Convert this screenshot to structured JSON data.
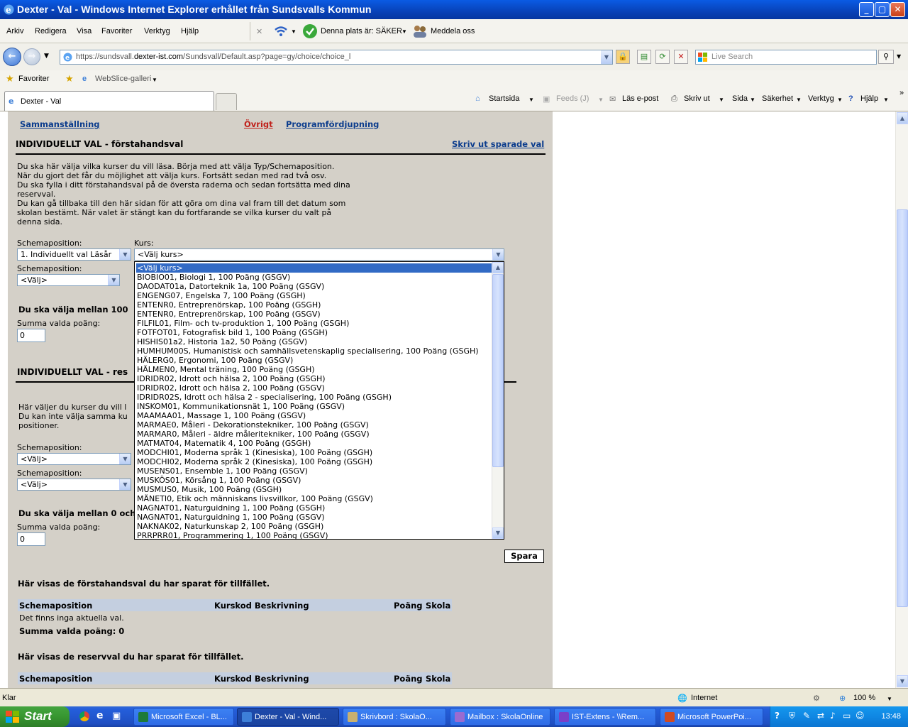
{
  "window": {
    "title": "Dexter - Val - Windows Internet Explorer erhållet från Sundsvalls Kommun",
    "min": "_",
    "max": "▢",
    "close": "✕"
  },
  "menu": [
    "Arkiv",
    "Redigera",
    "Visa",
    "Favoriter",
    "Verktyg",
    "Hjälp"
  ],
  "toolbar": {
    "safe_site": "Denna plats är: SÄKER",
    "notify": "Meddela oss"
  },
  "address": {
    "url_prefix": "https://sundsvall.",
    "url_domain": "dexter-ist.com",
    "url_rest": "/Sundsvall/Default.asp?page=gy/choice/choice_l",
    "search_placeholder": "Live Search"
  },
  "favbar": {
    "favorites": "Favoriter",
    "webslice": "WebSlice-galleri"
  },
  "tab": {
    "title": "Dexter - Val"
  },
  "commandbar": [
    "Startsida",
    "Feeds (J)",
    "Läs e-post",
    "Skriv ut",
    "Sida",
    "Säkerhet",
    "Verktyg",
    "Hjälp"
  ],
  "page": {
    "nav": {
      "summary": "Sammanställning",
      "other": "Övrigt",
      "program": "Programfördjupning"
    },
    "print_link": "Skriv ut sparade val",
    "section1": {
      "title": "INDIVIDUELLT VAL - förstahandsval",
      "intro": [
        "Du ska här välja vilka kurser du vill läsa. Börja med att välja Typ/Schemaposition.",
        "När du gjort det får du möjlighet att välja kurs. Fortsätt sedan med rad två osv.",
        "Du ska fylla i ditt förstahandsval på de översta raderna och sedan fortsätta med dina",
        "reservval.",
        "Du kan gå tillbaka till den här sidan för att göra om dina val fram till det datum som",
        "skolan bestämt. När valet är stängt kan du fortfarande se vilka kurser du valt på",
        "denna sida."
      ],
      "schema_label": "Schemaposition:",
      "kurs_label": "Kurs:",
      "schema1_value": "1. Individuellt val Läsår",
      "kurs1_value": "<Välj kurs>",
      "schema2_value": "<Välj>",
      "points_note": "Du ska välja mellan 100",
      "sum_label": "Summa valda poäng:",
      "sum_value": "0"
    },
    "section2": {
      "title": "INDIVIDUELLT VAL - res",
      "intro": [
        "Här väljer du kurser du vill l",
        "Du kan inte välja samma ku",
        "positioner."
      ],
      "schema_label": "Schemaposition:",
      "schema1_value": "<Välj>",
      "schema2_value": "<Välj>",
      "points_note": "Du ska välja mellan 0 och",
      "sum_label": "Summa valda poäng:",
      "sum_value": "0"
    },
    "save_button": "Spara",
    "saved_first": {
      "heading": "Här visas de förstahandsval du har sparat för tillfället.",
      "columns": [
        "Schemaposition",
        "Kurskod Beskrivning",
        "Poäng",
        "Skola"
      ],
      "empty": "Det finns inga aktuella val.",
      "sum": "Summa valda poäng: 0"
    },
    "saved_reserve": {
      "heading": "Här visas de reservval du har sparat för tillfället.",
      "columns": [
        "Schemaposition",
        "Kurskod Beskrivning",
        "Poäng",
        "Skola"
      ]
    }
  },
  "dropdown_options": [
    "<Välj kurs>",
    "BIOBIO01, Biologi 1, 100 Poäng (GSGV)",
    "DAODAT01a, Datorteknik 1a, 100 Poäng (GSGV)",
    "ENGENG07, Engelska 7, 100 Poäng (GSGH)",
    "ENTENR0, Entreprenörskap, 100 Poäng (GSGH)",
    "ENTENR0, Entreprenörskap, 100 Poäng (GSGV)",
    "FILFIL01, Film- och tv-produktion 1, 100 Poäng (GSGH)",
    "FOTFOT01, Fotografisk bild 1, 100 Poäng (GSGH)",
    "HISHIS01a2, Historia 1a2, 50 Poäng (GSGV)",
    "HUMHUM00S, Humanistisk och samhällsvetenskaplig specialisering, 100 Poäng (GSGH)",
    "HÄLERG0, Ergonomi, 100 Poäng (GSGV)",
    "HÄLMEN0, Mental träning, 100 Poäng (GSGH)",
    "IDRIDR02, Idrott och hälsa 2, 100 Poäng (GSGH)",
    "IDRIDR02, Idrott och hälsa 2, 100 Poäng (GSGV)",
    "IDRIDR02S, Idrott och hälsa 2 - specialisering, 100 Poäng (GSGH)",
    "INSKOM01, Kommunikationsnät 1, 100 Poäng (GSGV)",
    "MAAMAA01, Massage 1, 100 Poäng (GSGV)",
    "MARMAE0, Måleri - Dekorationstekniker, 100 Poäng (GSGV)",
    "MARMAR0, Måleri - äldre måleritekniker, 100 Poäng (GSGV)",
    "MATMAT04, Matematik 4, 100 Poäng (GSGH)",
    "MODCHI01, Moderna språk 1 (Kinesiska), 100 Poäng (GSGH)",
    "MODCHI02, Moderna språk 2 (Kinesiska), 100 Poäng (GSGH)",
    "MUSENS01, Ensemble 1, 100 Poäng (GSGV)",
    "MUSKÖS01, Körsång 1, 100 Poäng (GSGV)",
    "MUSMUS0, Musik, 100 Poäng (GSGH)",
    "MÄNETI0, Etik och människans livsvillkor, 100 Poäng (GSGV)",
    "NAGNAT01, Naturguidning 1, 100 Poäng (GSGH)",
    "NAGNAT01, Naturguidning 1, 100 Poäng (GSGV)",
    "NAKNAK02, Naturkunskap 2, 100 Poäng (GSGH)",
    "PRRPRR01, Programmering 1, 100 Poäng (GSGV)"
  ],
  "status": {
    "left": "Klar",
    "zone": "Internet",
    "zoom": "100 %"
  },
  "taskbar": {
    "start": "Start",
    "tasks": [
      {
        "label": "Microsoft Excel - BL...",
        "color": "#1d7a3a"
      },
      {
        "label": "Dexter - Val - Wind...",
        "color": "#3d7fd8"
      },
      {
        "label": "Skrivbord : SkolaO...",
        "color": "#c8b070"
      },
      {
        "label": "Mailbox : SkolaOnline",
        "color": "#9a6bd0"
      },
      {
        "label": "IST-Extens - \\\\Rem...",
        "color": "#7a3fc8"
      },
      {
        "label": "Microsoft PowerPoi...",
        "color": "#d14a22"
      }
    ],
    "clock": "13:48"
  }
}
